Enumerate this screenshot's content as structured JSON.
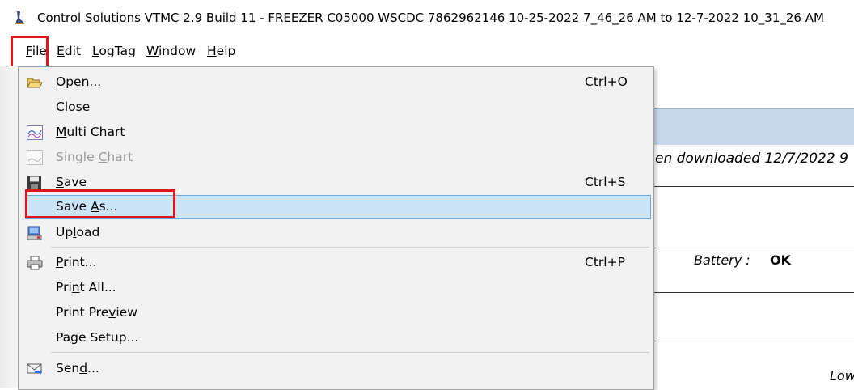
{
  "window": {
    "title": "Control Solutions VTMC 2.9 Build 11 - FREEZER C05000 WSCDC 7862962146 10-25-2022 7_46_26 AM to 12-7-2022 10_31_26 AM",
    "icon": "app-icon"
  },
  "menubar": {
    "file": {
      "first": "F",
      "rest": "ile"
    },
    "edit": {
      "first": "E",
      "rest": "dit"
    },
    "logtag": {
      "first": "L",
      "rest": "ogTag"
    },
    "window": {
      "first": "W",
      "rest": "indow"
    },
    "help": {
      "first": "H",
      "rest": "elp"
    }
  },
  "file_menu": {
    "open": {
      "a": "",
      "u": "O",
      "b": "pen...",
      "shortcut": "Ctrl+O",
      "icon": "folder-open-icon"
    },
    "close": {
      "a": "",
      "u": "C",
      "b": "lose"
    },
    "multi_chart": {
      "a": "",
      "u": "M",
      "b": "ulti Chart",
      "icon": "multi-chart-icon"
    },
    "single_chart": {
      "a": "Single ",
      "u": "C",
      "b": "hart",
      "icon": "single-chart-icon",
      "disabled": true
    },
    "save": {
      "a": "",
      "u": "S",
      "b": "ave",
      "shortcut": "Ctrl+S",
      "icon": "floppy-disk-icon"
    },
    "save_as": {
      "a": "Save ",
      "u": "A",
      "b": "s...",
      "selected": true
    },
    "upload": {
      "a": "Up",
      "u": "l",
      "b": "oad",
      "icon": "upload-icon"
    },
    "print": {
      "a": "",
      "u": "P",
      "b": "rint...",
      "shortcut": "Ctrl+P",
      "icon": "printer-icon"
    },
    "print_all": {
      "a": "Pri",
      "u": "n",
      "b": "t All..."
    },
    "print_preview": {
      "a": "Print Pre",
      "u": "v",
      "b": "iew"
    },
    "page_setup": {
      "a": "Pa",
      "u": "g",
      "b": "e Setup..."
    },
    "send": {
      "a": "Sen",
      "u": "d",
      "b": "...",
      "icon": "send-icon"
    }
  },
  "background": {
    "downloaded_text": "en downloaded 12/7/2022 9",
    "battery_label": "Battery :",
    "battery_value": "OK",
    "low_text": "Low"
  },
  "colors": {
    "highlight_box": "#e01515",
    "selected_row": "#cce4f7",
    "selected_border": "#6aa9dc",
    "header_band": "#c8d8ec"
  }
}
